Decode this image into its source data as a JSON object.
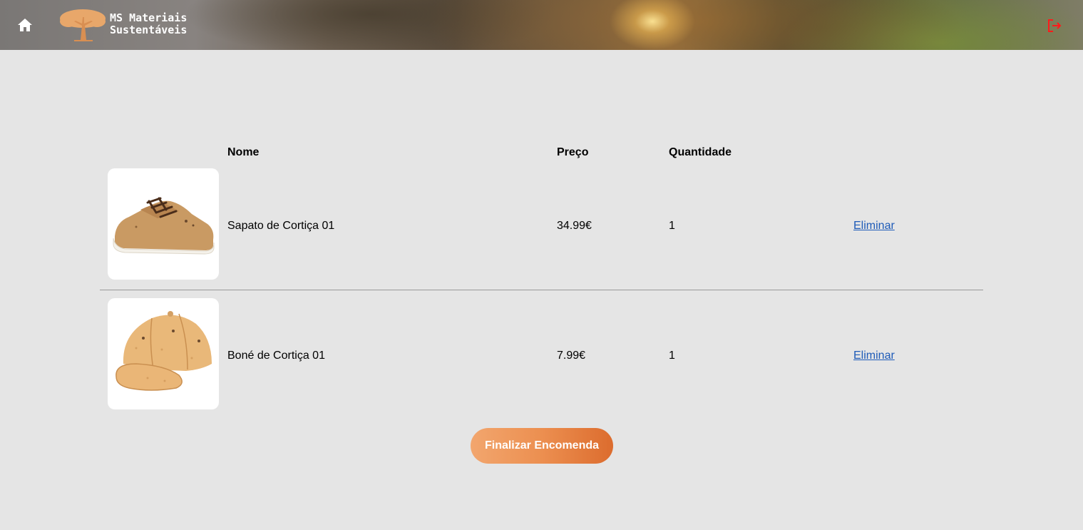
{
  "header": {
    "home_icon": "home-icon",
    "brand_line1": "MS Materiais",
    "brand_line2": "Sustentáveis",
    "logout_icon": "logout-icon",
    "logout_color": "#ff1a1a"
  },
  "cart": {
    "columns": {
      "name": "Nome",
      "price": "Preço",
      "quantity": "Quantidade"
    },
    "items": [
      {
        "image": "cork-shoe-image",
        "name": "Sapato de Cortiça 01",
        "price": "34.99€",
        "quantity": "1",
        "remove_label": "Eliminar"
      },
      {
        "image": "cork-cap-image",
        "name": "Boné de Cortiça 01",
        "price": "7.99€",
        "quantity": "1",
        "remove_label": "Eliminar"
      }
    ],
    "checkout_label": "Finalizar Encomenda"
  },
  "colors": {
    "background": "#e5e5e5",
    "link": "#1e5bb8",
    "checkout_gradient_start": "#f2a66e",
    "checkout_gradient_end": "#dc6c2e",
    "logo_tree": "#e8a76a"
  }
}
